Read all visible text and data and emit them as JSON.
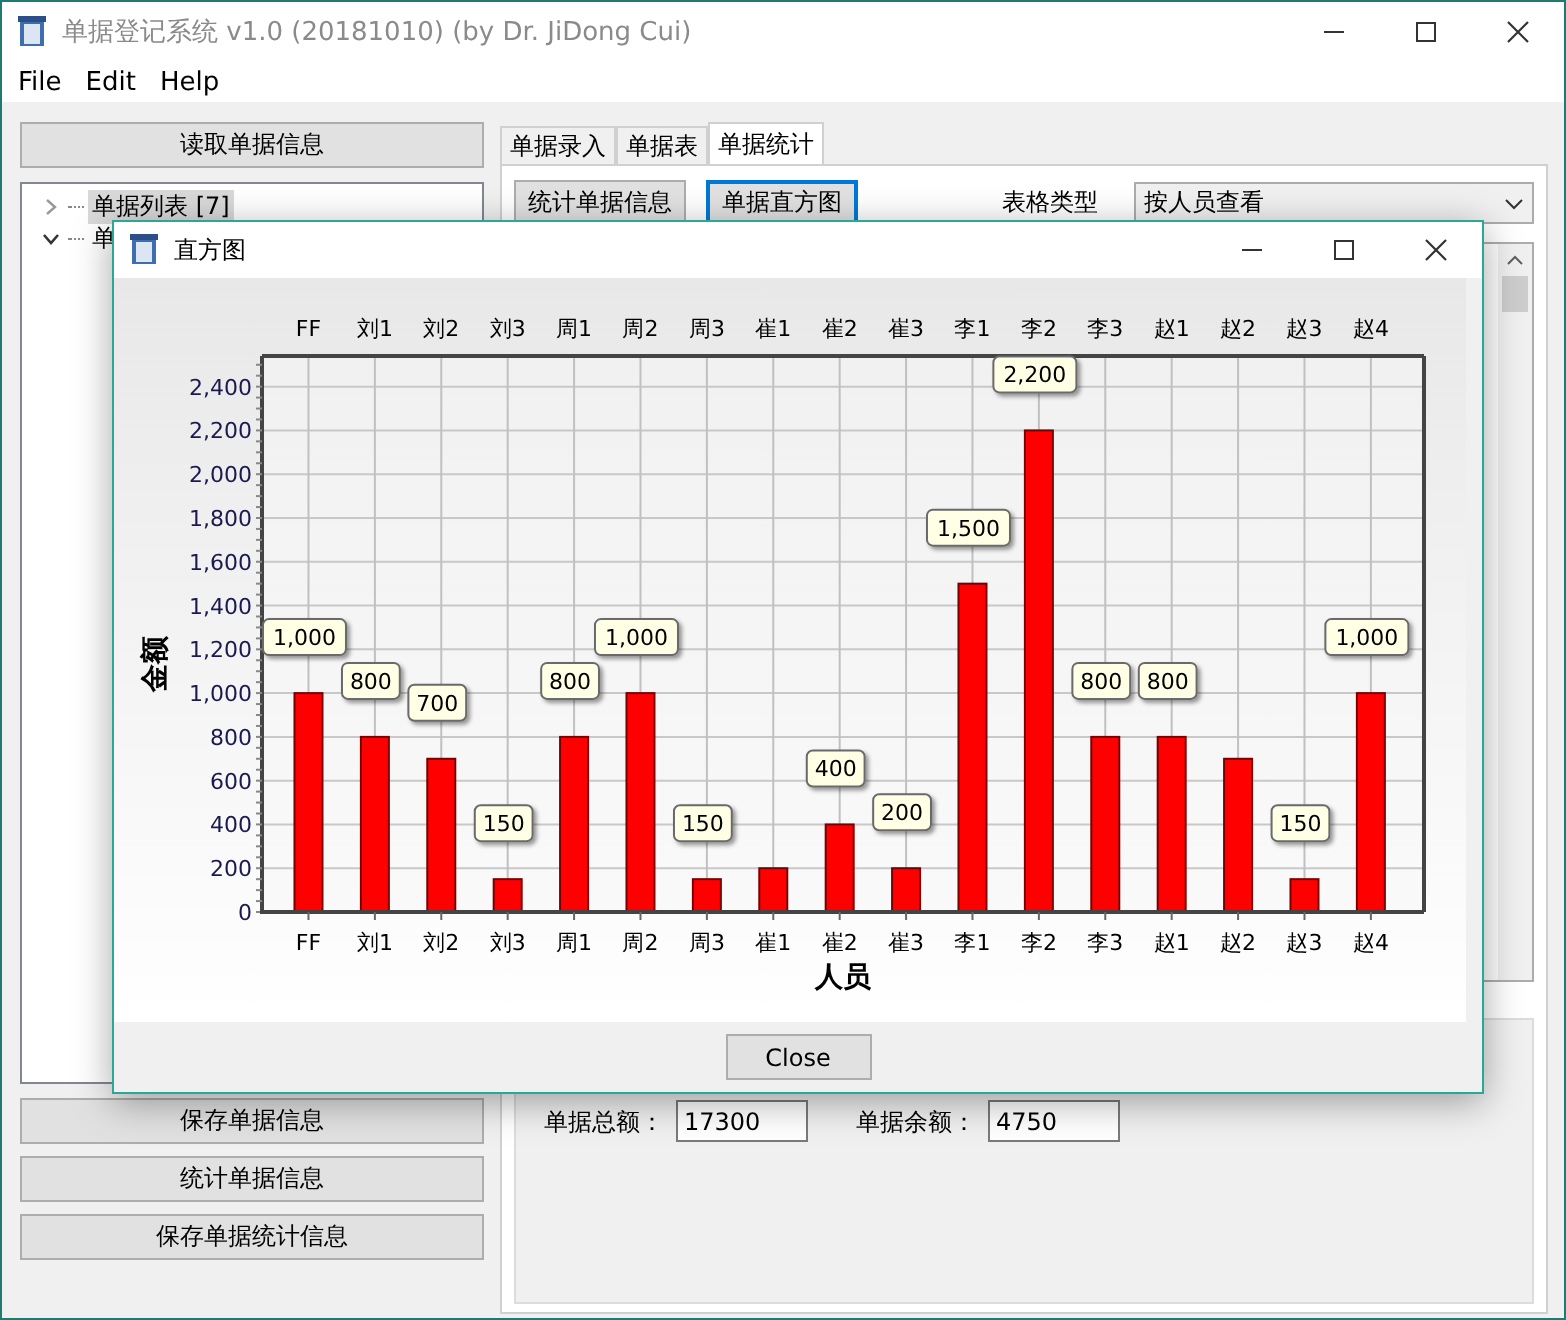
{
  "window": {
    "title": "单据登记系统 v1.0 (20181010) (by Dr. JiDong Cui)"
  },
  "menu": [
    "File",
    "Edit",
    "Help"
  ],
  "left_panel": {
    "top_button": "读取单据信息",
    "tree": [
      {
        "label": "单据列表 [7]",
        "expanded": false,
        "selected": true
      },
      {
        "label": "单",
        "expanded": true,
        "selected": false
      }
    ],
    "bottom_buttons": [
      "保存单据信息",
      "统计单据信息",
      "保存单据统计信息"
    ]
  },
  "tabs": [
    {
      "label": "单据录入",
      "selected": false
    },
    {
      "label": "单据表",
      "selected": false
    },
    {
      "label": "单据统计",
      "selected": true
    }
  ],
  "toolbar": {
    "buttons": [
      {
        "label": "统计单据信息",
        "focused": false
      },
      {
        "label": "单据直方图",
        "focused": true
      }
    ],
    "table_type_label": "表格类型",
    "table_type_value": "按人员查看"
  },
  "summary": {
    "fields": [
      {
        "label": "单据总额：",
        "value": "17300"
      },
      {
        "label": "单据余额：",
        "value": "4750"
      }
    ]
  },
  "dialog": {
    "title": "直方图",
    "close_button": "Close",
    "chart_data": {
      "type": "bar",
      "xlabel": "人员",
      "ylabel": "金额",
      "categories": [
        "FF",
        "刘1",
        "刘2",
        "刘3",
        "周1",
        "周2",
        "周3",
        "崔1",
        "崔2",
        "崔3",
        "李1",
        "李2",
        "李3",
        "赵1",
        "赵2",
        "赵3",
        "赵4"
      ],
      "annotations": [
        {
          "text": "FF"
        },
        {
          "text": "刘1"
        },
        {
          "text": "刘2"
        },
        {
          "text": "刘3"
        },
        {
          "text": "周1"
        },
        {
          "text": "周2"
        },
        {
          "text": "周3"
        },
        {
          "text": "崔1"
        },
        {
          "text": "崔2"
        },
        {
          "text": "崔3"
        },
        {
          "text": "李1"
        },
        {
          "text": "李2"
        },
        {
          "text": "李3"
        },
        {
          "text": "赵1"
        },
        {
          "text": "赵2"
        },
        {
          "text": "赵3"
        },
        {
          "text": "赵4"
        }
      ],
      "grid": true,
      "series": [
        {
          "color": "#ff0000",
          "values": [
            1000,
            800,
            700,
            150,
            800,
            1000,
            150,
            200,
            400,
            200,
            1500,
            2200,
            800,
            800,
            700,
            150,
            1000
          ]
        }
      ],
      "value_labels": [
        "1,000",
        "800",
        "700",
        "150",
        "800",
        "1,000",
        "150",
        null,
        "400",
        "200",
        "1,500",
        "2,200",
        "800",
        "800",
        null,
        "150",
        "1,000"
      ],
      "ylim": [
        0,
        2540
      ],
      "yticks": [
        {
          "value": 0,
          "label": "0"
        },
        {
          "value": 200,
          "label": "200"
        },
        {
          "value": 400,
          "label": "400"
        },
        {
          "value": 600,
          "label": "600"
        },
        {
          "value": 800,
          "label": "800"
        },
        {
          "value": 1000,
          "label": "1,000"
        },
        {
          "value": 1200,
          "label": "1,200"
        },
        {
          "value": 1400,
          "label": "1,400"
        },
        {
          "value": 1600,
          "label": "1,600"
        },
        {
          "value": 1800,
          "label": "1,800"
        },
        {
          "value": 2000,
          "label": "2,000"
        },
        {
          "value": 2200,
          "label": "2,200"
        },
        {
          "value": 2400,
          "label": "2,400"
        }
      ]
    }
  }
}
